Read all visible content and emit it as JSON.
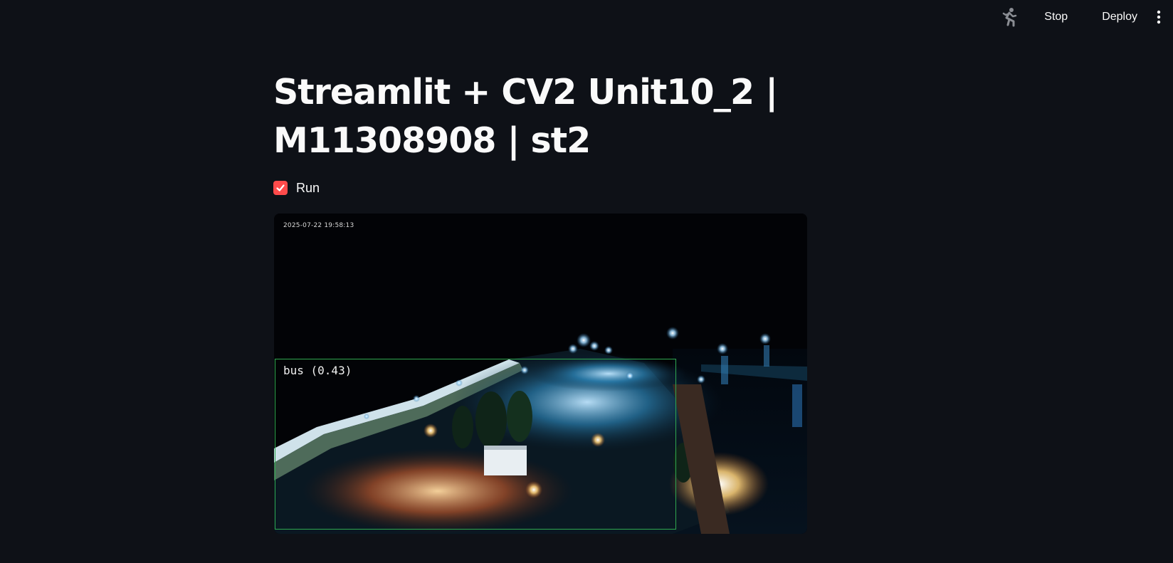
{
  "toolbar": {
    "stop_label": "Stop",
    "deploy_label": "Deploy",
    "status_icon": "running-man-icon",
    "menu_icon": "vertical-ellipsis-icon"
  },
  "main": {
    "title": "Streamlit + CV2 Unit10_2 | M11308908 | st2",
    "checkbox": {
      "label": "Run",
      "checked": true,
      "color": "#ff4b4b"
    },
    "video": {
      "timestamp": "2025-07-22 19:58:13",
      "detection": {
        "label": "bus (0.43)",
        "box_color": "#2fa84f"
      }
    }
  },
  "colors": {
    "background": "#0e1117",
    "text": "#fafafa",
    "accent": "#ff4b4b"
  }
}
